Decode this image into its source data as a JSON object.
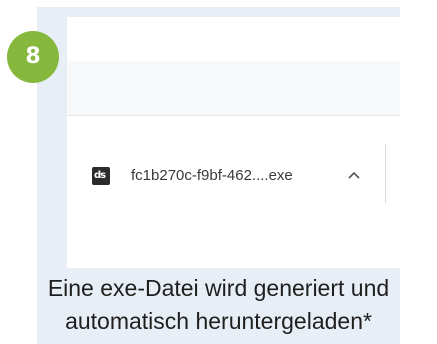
{
  "step": {
    "number": "8",
    "badge_color": "#85b83d"
  },
  "download": {
    "icon": "installer-file-icon",
    "icon_glyph": "ds",
    "filename": "fc1b270c-f9bf-462....exe",
    "menu_icon": "chevron-up-icon"
  },
  "caption": {
    "line1": "Eine exe-Datei wird generiert und",
    "line2": "automatisch heruntergeladen*"
  }
}
